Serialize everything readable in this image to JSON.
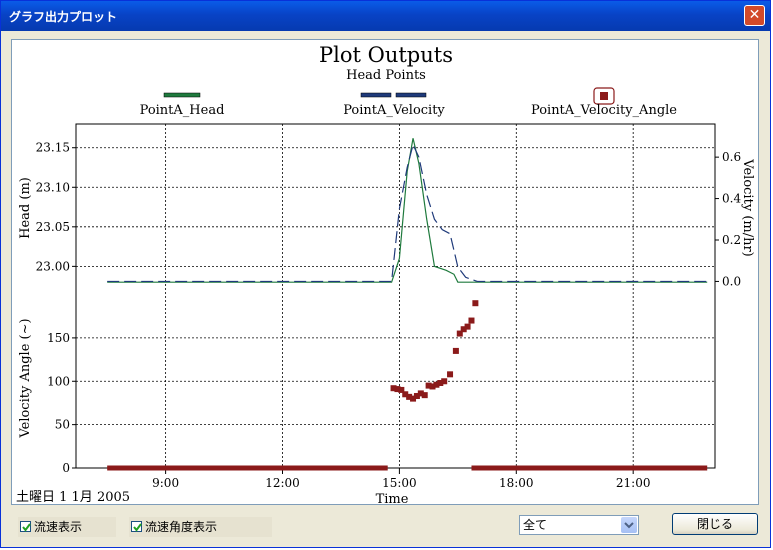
{
  "window": {
    "title": "グラフ出力プロット",
    "close_glyph": "✕"
  },
  "plot": {
    "title": "Plot Outputs",
    "subtitle": "Head Points",
    "legend": [
      "PointA_Head",
      "PointA_Velocity",
      "PointA_Velocity_Angle"
    ],
    "date_label": "土曜日 1  1月 2005",
    "x_axis_label": "Time",
    "colors": {
      "head": "#1f7a3d",
      "velocity": "#1f3a7a",
      "angle": "#8b1a1a"
    }
  },
  "chart_data": [
    {
      "type": "line",
      "title": "Plot Outputs",
      "subtitle": "Head Points",
      "x_ticks": [
        "9:00",
        "12:00",
        "15:00",
        "18:00",
        "21:00"
      ],
      "x_tick_values": [
        9,
        12,
        15,
        18,
        21
      ],
      "xlim": [
        6.7,
        23.1
      ],
      "ylabel": "Head (m)",
      "y_ticks": [
        "23.00",
        "23.05",
        "23.10",
        "23.15"
      ],
      "y_tick_values": [
        23.0,
        23.05,
        23.1,
        23.15
      ],
      "ylim": [
        22.96,
        23.18
      ],
      "y2label": "Velocity (m/hr)",
      "y2_ticks": [
        "0.0",
        "0.2",
        "0.4",
        "0.6"
      ],
      "y2_tick_values": [
        0,
        0.2,
        0.4,
        0.6
      ],
      "y2lim": [
        -0.08,
        0.76
      ],
      "grid": true,
      "series": [
        {
          "name": "PointA_Head",
          "axis": "left",
          "style": "solid",
          "x": [
            7.5,
            14.8,
            15.0,
            15.2,
            15.35,
            15.5,
            15.7,
            15.9,
            16.2,
            16.4,
            16.5,
            16.7,
            17.0,
            22.9
          ],
          "y": [
            22.98,
            22.98,
            23.01,
            23.12,
            23.162,
            23.13,
            23.06,
            23.0,
            22.995,
            22.99,
            22.98,
            22.98,
            22.98,
            22.98
          ]
        },
        {
          "name": "PointA_Velocity",
          "axis": "right",
          "style": "dashed",
          "x": [
            7.5,
            14.8,
            15.0,
            15.2,
            15.35,
            15.5,
            15.7,
            15.9,
            16.1,
            16.3,
            16.5,
            16.7,
            17.0,
            22.9
          ],
          "y": [
            0.0,
            0.0,
            0.35,
            0.55,
            0.66,
            0.6,
            0.42,
            0.3,
            0.25,
            0.23,
            0.07,
            0.02,
            0.0,
            0.0
          ]
        }
      ]
    },
    {
      "type": "scatter",
      "series_name": "PointA_Velocity_Angle",
      "ylabel": "Velocity Angle (~)",
      "y_ticks": [
        "0",
        "50",
        "100",
        "150"
      ],
      "y_tick_values": [
        0,
        50,
        100,
        150
      ],
      "ylim": [
        0,
        196
      ],
      "x_ticks": [
        "9:00",
        "12:00",
        "15:00",
        "18:00",
        "21:00"
      ],
      "x_tick_values": [
        9,
        12,
        15,
        18,
        21
      ],
      "xlim": [
        6.7,
        23.1
      ],
      "x_label": "Time",
      "grid": true,
      "points": {
        "x": [
          14.85,
          14.95,
          15.05,
          15.15,
          15.25,
          15.35,
          15.45,
          15.55,
          15.65,
          15.75,
          15.85,
          15.95,
          16.05,
          16.15,
          16.3,
          16.45,
          16.55,
          16.65,
          16.75,
          16.85,
          16.95
        ],
        "y": [
          92,
          91,
          90,
          85,
          82,
          80,
          83,
          86,
          84,
          95,
          94,
          96,
          98,
          100,
          108,
          135,
          155,
          160,
          163,
          170,
          190
        ]
      },
      "baseline_segments": [
        [
          7.5,
          14.7
        ],
        [
          16.85,
          22.9
        ]
      ],
      "baseline_value": 0
    }
  ],
  "controls": {
    "checkbox_velocity": {
      "label": "流速表示",
      "checked": true
    },
    "checkbox_angle": {
      "label": "流速角度表示",
      "checked": true
    },
    "select": {
      "value": "全て"
    },
    "close_button": "閉じる"
  }
}
